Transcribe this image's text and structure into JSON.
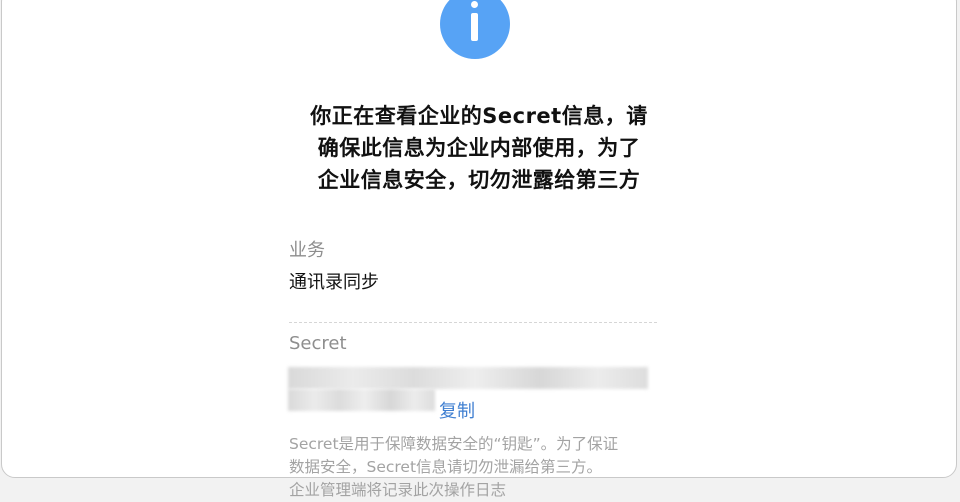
{
  "notice": {
    "icon": "info-icon",
    "icon_color": "#57a3f5",
    "line1": "你正在查看企业的Secret信息，请",
    "line2": "确保此信息为企业内部使用，为了",
    "line3": "企业信息安全，切勿泄露给第三方"
  },
  "business": {
    "label": "业务",
    "value": "通讯录同步"
  },
  "secret": {
    "label": "Secret",
    "value_state": "masked",
    "copy_label": "复制",
    "link_color": "#3f7fd1"
  },
  "note": {
    "line1": "Secret是用于保障数据安全的“钥匙”。为了保证",
    "line2": "数据安全，Secret信息请切勿泄漏给第三方。",
    "line3": "企业管理端将记录此次操作日志"
  }
}
